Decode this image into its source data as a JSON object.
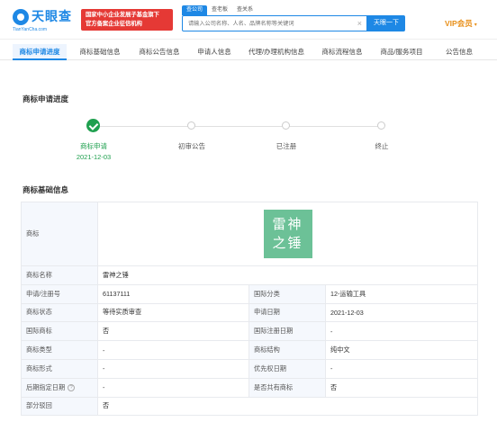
{
  "header": {
    "logo_text": "天眼查",
    "logo_sub": "TianYanCha.com",
    "banner_line1": "国家中小企业发展子基金旗下",
    "banner_line2": "官方备案企业征信机构",
    "search_tabs": [
      "查公司",
      "查老板",
      "查关系"
    ],
    "search_placeholder": "请输入公司名称、人名、品牌名称等关键词",
    "search_clear": "×",
    "search_button": "天眼一下",
    "vip_label": "VIP会员",
    "vip_caret": "▾"
  },
  "nav": {
    "tabs": [
      "商标申请进度",
      "商标基础信息",
      "商标公告信息",
      "申请人信息",
      "代理/办理机构信息",
      "商标流程信息",
      "商品/服务项目",
      "公告信息"
    ]
  },
  "progress": {
    "title": "商标申请进度",
    "steps": [
      {
        "label": "商标申请",
        "date": "2021-12-03",
        "done": true
      },
      {
        "label": "初审公告",
        "date": "",
        "done": false
      },
      {
        "label": "已注册",
        "date": "",
        "done": false
      },
      {
        "label": "终止",
        "date": "",
        "done": false
      }
    ]
  },
  "basic": {
    "title": "商标基础信息",
    "trademark_label": "商标",
    "trademark_image_line1": "雷神",
    "trademark_image_line2": "之锤",
    "rows": [
      {
        "k1": "商标名称",
        "v1": "雷神之锤"
      },
      {
        "k1": "申请/注册号",
        "v1": "61137111",
        "k2": "国际分类",
        "v2": "12-运输工具"
      },
      {
        "k1": "商标状态",
        "v1": "等待实质审查",
        "k2": "申请日期",
        "v2": "2021-12-03"
      },
      {
        "k1": "国际商标",
        "v1": "否",
        "k2": "国际注册日期",
        "v2": "-"
      },
      {
        "k1": "商标类型",
        "v1": "-",
        "k2": "商标结构",
        "v2": "纯中文"
      },
      {
        "k1": "商标形式",
        "v1": "-",
        "k2": "优先权日期",
        "v2": "-"
      },
      {
        "k1": "后期指定日期",
        "v1": "-",
        "k2": "是否共有商标",
        "v2": "否"
      },
      {
        "k1": "部分驳回",
        "v1": "否"
      }
    ],
    "help_icon": "?"
  },
  "colors": {
    "brand_blue": "#1e88e5",
    "done_green": "#1fa04f",
    "vip_orange": "#e8901b",
    "banner_red": "#e53935",
    "trademark_green": "#6cc197"
  }
}
